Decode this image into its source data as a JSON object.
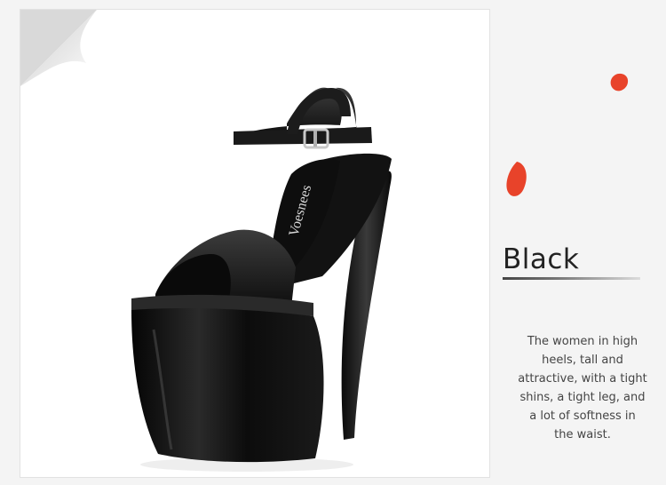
{
  "product": {
    "brand_on_insole": "Voesnees",
    "color_name": "Black",
    "description_lines": [
      "The women in high",
      "heels, tall and",
      "attractive, with a tight",
      "shins, a tight leg, and",
      "a lot of softness in",
      "the waist."
    ]
  },
  "colors": {
    "shoe": "#141414",
    "accent_petal": "#e8432a",
    "background": "#f4f4f4"
  }
}
